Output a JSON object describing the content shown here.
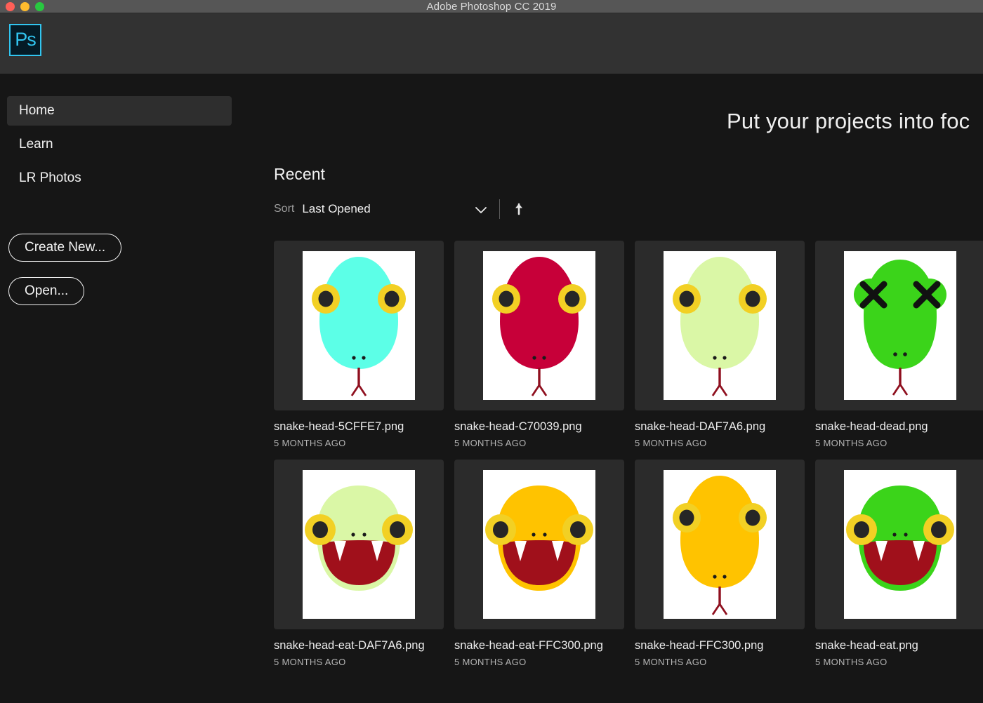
{
  "window": {
    "title": "Adobe Photoshop CC 2019",
    "traffic_lights": [
      "close-red",
      "minimize-yellow",
      "zoom-green"
    ],
    "logo_text": "Ps",
    "logo_color": "#31c5f0"
  },
  "sidebar": {
    "items": [
      {
        "label": "Home",
        "selected": true
      },
      {
        "label": "Learn",
        "selected": false
      },
      {
        "label": "LR Photos",
        "selected": false
      }
    ],
    "buttons": [
      {
        "label": "Create New..."
      },
      {
        "label": "Open..."
      }
    ]
  },
  "banner": {
    "text": "Put your projects into foc"
  },
  "recent": {
    "heading": "Recent",
    "sort_label": "Sort",
    "sort_value": "Last Opened",
    "sort_dropdown_icon": "chevron-down-icon",
    "sort_direction_icon": "arrow-up-icon",
    "files": [
      {
        "name": "snake-head-5CFFE7.png",
        "time": "5 MONTHS AGO",
        "art": {
          "variant": "closed",
          "body_color": "#5CFFE7",
          "eye_ring": "#F2D024",
          "pupil": "#262626",
          "tongue": "#8f0f1e"
        }
      },
      {
        "name": "snake-head-C70039.png",
        "time": "5 MONTHS AGO",
        "art": {
          "variant": "closed",
          "body_color": "#C70039",
          "eye_ring": "#F2D024",
          "pupil": "#262626",
          "tongue": "#8f0f1e"
        }
      },
      {
        "name": "snake-head-DAF7A6.png",
        "time": "5 MONTHS AGO",
        "art": {
          "variant": "closed",
          "body_color": "#DAF7A6",
          "eye_ring": "#F2D024",
          "pupil": "#262626",
          "tongue": "#8f0f1e"
        }
      },
      {
        "name": "snake-head-dead.png",
        "time": "5 MONTHS AGO",
        "art": {
          "variant": "dead",
          "body_color": "#3BD41A",
          "eye_ring": "#000000",
          "pupil": "#000000",
          "tongue": "#8f0f1e"
        }
      },
      {
        "name": "snake-head-eat-DAF7A6.png",
        "time": "5 MONTHS AGO",
        "art": {
          "variant": "eat",
          "body_color": "#DAF7A6",
          "eye_ring": "#F2D024",
          "pupil": "#262626",
          "mouth": "#A0101B",
          "fang": "#ffffff"
        }
      },
      {
        "name": "snake-head-eat-FFC300.png",
        "time": "5 MONTHS AGO",
        "art": {
          "variant": "eat",
          "body_color": "#FFC300",
          "eye_ring": "#F2D024",
          "pupil": "#262626",
          "mouth": "#A0101B",
          "fang": "#ffffff"
        }
      },
      {
        "name": "snake-head-FFC300.png",
        "time": "5 MONTHS AGO",
        "art": {
          "variant": "closed",
          "body_color": "#FFC300",
          "eye_ring": "#F2D024",
          "pupil": "#262626",
          "tongue": "#8f0f1e"
        }
      },
      {
        "name": "snake-head-eat.png",
        "time": "5 MONTHS AGO",
        "art": {
          "variant": "eat",
          "body_color": "#3BD41A",
          "eye_ring": "#F2D024",
          "pupil": "#262626",
          "mouth": "#A0101B",
          "fang": "#ffffff"
        }
      }
    ]
  }
}
